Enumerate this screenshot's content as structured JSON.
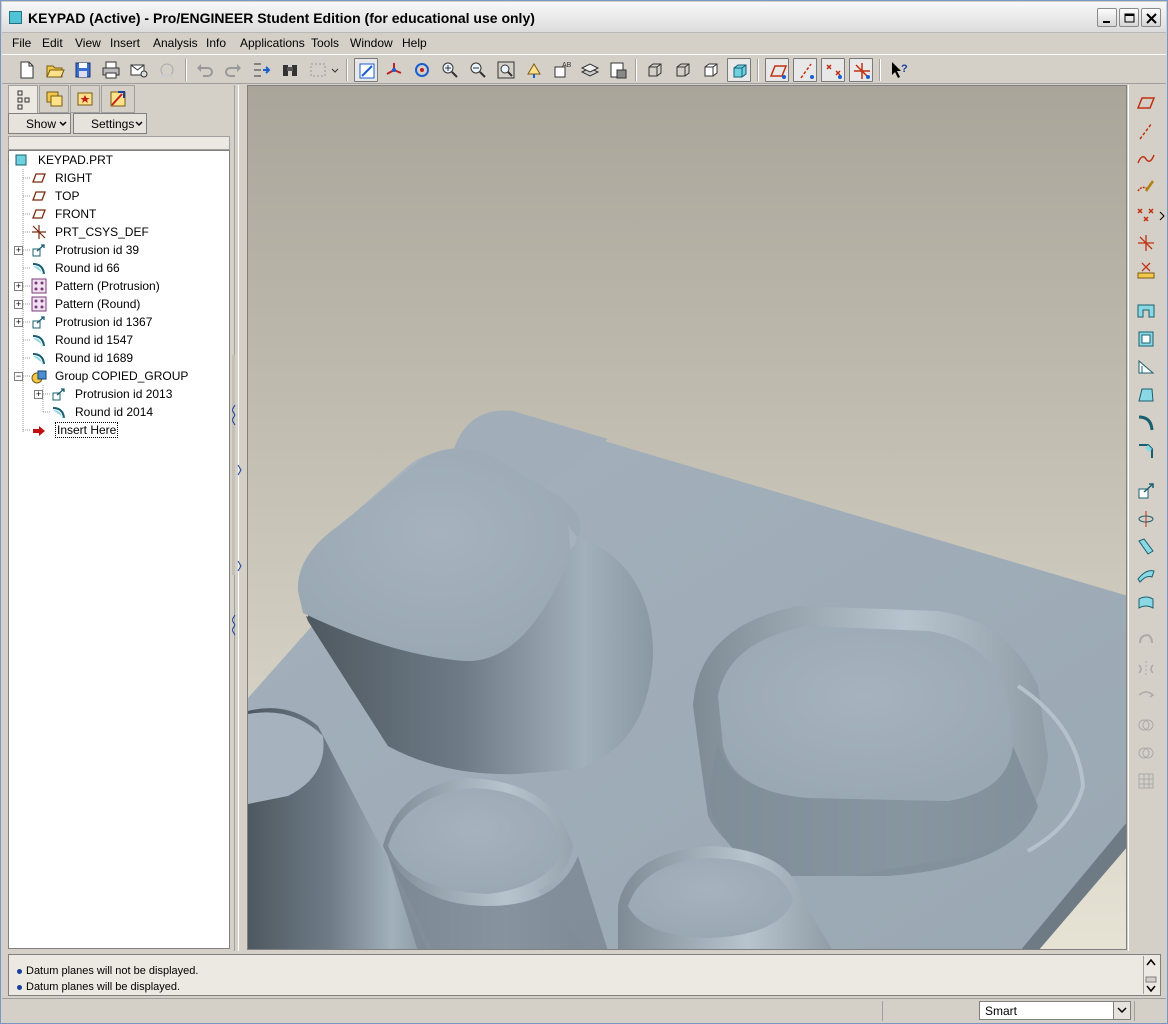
{
  "window": {
    "title": "KEYPAD (Active) - Pro/ENGINEER Student Edition (for educational use only)"
  },
  "menu": [
    "File",
    "Edit",
    "View",
    "Insert",
    "Analysis",
    "Info",
    "Applications",
    "Tools",
    "Window",
    "Help"
  ],
  "panel": {
    "show_label": "Show",
    "settings_label": "Settings"
  },
  "tree": {
    "root": "KEYPAD.PRT",
    "items": [
      {
        "label": "RIGHT"
      },
      {
        "label": "TOP"
      },
      {
        "label": "FRONT"
      },
      {
        "label": "PRT_CSYS_DEF"
      },
      {
        "label": "Protrusion id 39"
      },
      {
        "label": "Round id 66"
      },
      {
        "label": "Pattern (Protrusion)"
      },
      {
        "label": "Pattern (Round)"
      },
      {
        "label": "Protrusion id 1367"
      },
      {
        "label": "Round id 1547"
      },
      {
        "label": "Round id 1689"
      },
      {
        "label": "Group COPIED_GROUP"
      },
      {
        "label": "Protrusion id 2013"
      },
      {
        "label": "Round id 2014"
      },
      {
        "label": "Insert Here"
      }
    ]
  },
  "messages": [
    "Datum planes will not be displayed.",
    "Datum planes will be displayed."
  ],
  "status": {
    "filter_value": "Smart"
  },
  "colors": {
    "part_surface": "#9fadb8",
    "background_top": "#a9a59a",
    "background_bottom": "#e6e2d4"
  }
}
